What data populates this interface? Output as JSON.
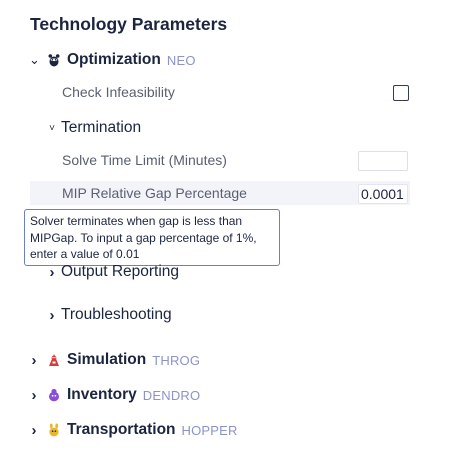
{
  "title": "Technology Parameters",
  "engines": [
    {
      "name": "Optimization",
      "tag": "NEO",
      "expanded_chevron": "⌄",
      "icon": "raccoon-icon"
    },
    {
      "name": "Simulation",
      "tag": "THROG",
      "chevron": "›",
      "icon": "throg-icon"
    },
    {
      "name": "Inventory",
      "tag": "DENDRO",
      "chevron": "›",
      "icon": "dendro-icon"
    },
    {
      "name": "Transportation",
      "tag": "HOPPER",
      "chevron": "›",
      "icon": "hopper-icon"
    }
  ],
  "optimization": {
    "check_infeasibility": {
      "label": "Check Infeasibility",
      "checked": false
    },
    "termination": {
      "label": "Termination",
      "chevron": "˅",
      "solve_time_limit": {
        "label": "Solve Time Limit (Minutes)",
        "value": ""
      },
      "mip_gap": {
        "label": "MIP Relative Gap Percentage",
        "value": "0.0001"
      }
    },
    "output_reporting": {
      "label": "Output Reporting",
      "chevron": "›"
    },
    "troubleshooting": {
      "label": "Troubleshooting",
      "chevron": "›"
    }
  },
  "tooltip": {
    "line1": "Solver terminates when gap is less than",
    "line2": "MIPGap. To input a gap percentage of 1%,",
    "line3": "enter a value of 0.01"
  },
  "colors": {
    "heading": "#1c2540",
    "tag": "#8b93c9",
    "param_label": "#5a6070",
    "tooltip_border": "#6d7fc0",
    "highlight": "#f3f4fa",
    "simulation_icon": "#d63a3a",
    "inventory_icon": "#8a4fd6",
    "transportation_icon": "#e8b72c"
  }
}
